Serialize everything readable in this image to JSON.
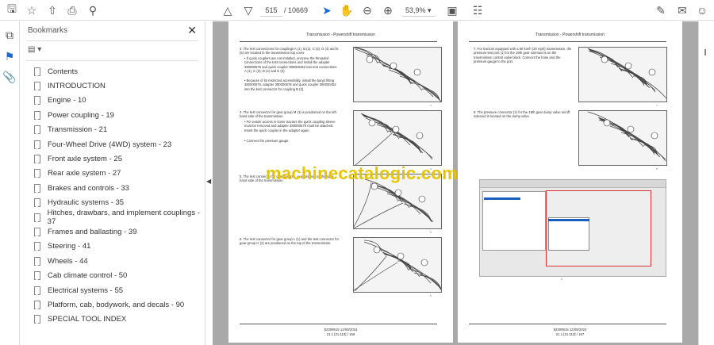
{
  "toolbar": {
    "current_page": "515",
    "total_pages": "/ 10669",
    "zoom": "53,9%"
  },
  "bookmarks": {
    "title": "Bookmarks",
    "items": [
      "Contents",
      "INTRODUCTION",
      "Engine - 10",
      "Power coupling - 19",
      "Transmission - 21",
      "Four-Wheel Drive (4WD) system - 23",
      "Front axle system - 25",
      "Rear axle system - 27",
      "Brakes and controls - 33",
      "Hydraulic systems - 35",
      "Hitches, drawbars, and implement couplings - 37",
      "Frames and ballasting - 39",
      "Steering - 41",
      "Wheels - 44",
      "Cab climate control - 50",
      "Electrical systems - 55",
      "Platform, cab, bodywork, and decals - 90",
      "SPECIAL TOOL INDEX"
    ]
  },
  "page1": {
    "header": "Transmission - Powershift transmission",
    "steps": [
      "3.  The test connections for couplings A (1), B (2), C (3), D (4) and E (5) are located in the transmission top cover.",
      "• If quick couplers are not installed, unscrew the threaded connections of the test connections and install the adapter 380000578 and quick coupler 380000452 into test connections A (1), C (3), D (4) and E (5).",
      "• Because of its restricted accessibility, install the banjo fitting 380000575, adapter 380000578 and quick coupler 380000452 into the test connector for coupling B (2).",
      "4.  The test connector for gear group M (1) is positioned on the left-hand side of the transmission.",
      "• For easier access in some tractors the quick coupling sleeve must be removed and adapter 380000579 must be attached. Insert the quick coupler in the adapter again.",
      "• Connect the pressure gauge.",
      "5.  The test connector for gear group ... is positioned on the right-hand side of the transmission.",
      "6.  The test connector for gear group L (1) and the test connector for gear group H (2) are positioned on the top of the transmission."
    ],
    "figs": [
      "3",
      "4",
      "5",
      "6"
    ],
    "footer": [
      "92309515 12/08/2024",
      "21.1 [21.113] / 166"
    ]
  },
  "page2": {
    "header": "Transmission - Powershift transmission",
    "steps": [
      "7.  For tractors equipped with a 50 km/h (30 mph) transmission, the pressure test port (1) for the 19th gear solenoid is on the transmission control valve block. Connect the hose and the pressure gauge to the port.",
      "8.  The pressure connector (1) for the 19th gear dump valve on/off solenoid is located on the dump valve."
    ],
    "figs": [
      "7",
      "8",
      "9"
    ],
    "footer": [
      "92309515 12/08/2024",
      "21.1 [21.113] / 167"
    ]
  },
  "watermark": "machinecatalogic.com"
}
